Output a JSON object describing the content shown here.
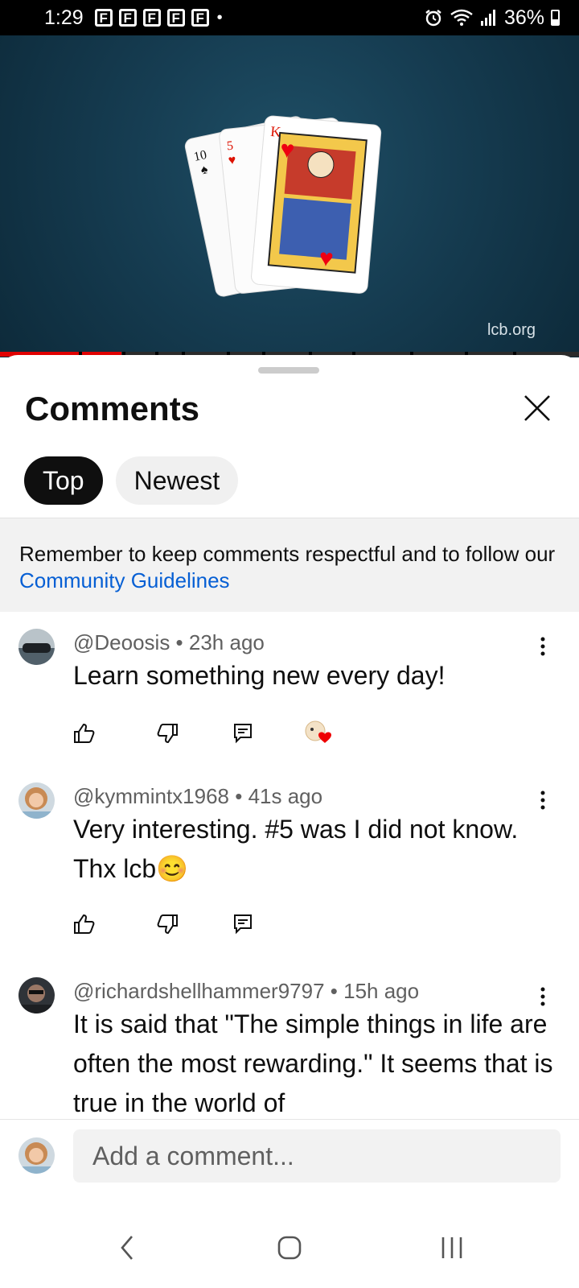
{
  "status_bar": {
    "time": "1:29",
    "notification_icons": [
      "F",
      "F",
      "F",
      "F",
      "F"
    ],
    "dot": "•",
    "battery": "36%"
  },
  "video": {
    "watermark": "lcb.org",
    "progress_fraction": 0.21,
    "card_labels": {
      "ten": "10",
      "five": "5",
      "king": "K"
    }
  },
  "sheet": {
    "title": "Comments",
    "tabs": [
      {
        "label": "Top",
        "active": true
      },
      {
        "label": "Newest",
        "active": false
      }
    ],
    "notice": {
      "text": "Remember to keep comments respectful and to follow our ",
      "link": "Community Guidelines"
    }
  },
  "comments": [
    {
      "author": "@Deoosis",
      "time": "23h ago",
      "text": "Learn something new every day!",
      "creator_heart": true
    },
    {
      "author": "@kymmintx1968",
      "time": "41s ago",
      "text": "Very interesting. #5 was I did not know. Thx lcb",
      "emoji": "😊",
      "creator_heart": false
    },
    {
      "author": "@richardshellhammer9797",
      "time": "15h ago",
      "text": "It is said that \"The simple things in life are often the most rewarding.\" It seems that is true in the world of"
    }
  ],
  "composer": {
    "placeholder": "Add a comment..."
  },
  "colors": {
    "accent": "#e00000",
    "link": "#065fd4",
    "chip_active": "#0f0f0f"
  }
}
